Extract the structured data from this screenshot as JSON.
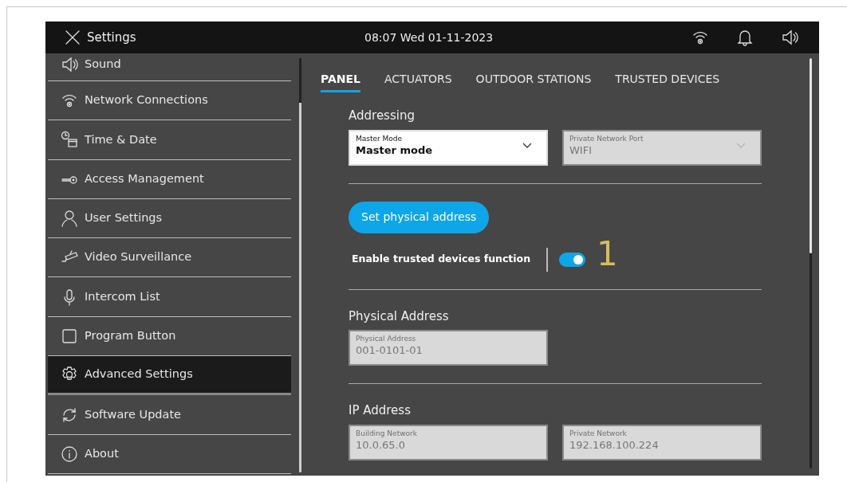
{
  "header": {
    "title": "Settings",
    "datetime": "08:07  Wed 01-11-2023"
  },
  "sidebar": {
    "items": [
      {
        "label": "Sound",
        "selected": false
      },
      {
        "label": "Network Connections",
        "selected": false
      },
      {
        "label": "Time & Date",
        "selected": false
      },
      {
        "label": "Access Management",
        "selected": false
      },
      {
        "label": "User Settings",
        "selected": false
      },
      {
        "label": "Video Surveillance",
        "selected": false
      },
      {
        "label": "Intercom List",
        "selected": false
      },
      {
        "label": "Program Button",
        "selected": false
      },
      {
        "label": "Advanced Settings",
        "selected": true
      },
      {
        "label": "Software Update",
        "selected": false
      },
      {
        "label": "About",
        "selected": false
      }
    ]
  },
  "tabs": [
    {
      "label": "PANEL",
      "selected": true
    },
    {
      "label": "ACTUATORS",
      "selected": false
    },
    {
      "label": "OUTDOOR STATIONS",
      "selected": false
    },
    {
      "label": "TRUSTED DEVICES",
      "selected": false
    }
  ],
  "sections": [
    {
      "kind": "fields",
      "title": "Addressing",
      "fields": [
        {
          "label": "Master Mode",
          "value": "Master mode",
          "disabled": false,
          "dropdown": true
        },
        {
          "label": "Private Network Port",
          "value": "WIFI",
          "disabled": true,
          "dropdown": true
        }
      ]
    },
    {
      "kind": "actions",
      "button": "Set physical address",
      "toggle": {
        "label": "Enable trusted devices function",
        "on": true
      },
      "annotation": "1"
    },
    {
      "kind": "fields",
      "title": "Physical Address",
      "fields": [
        {
          "label": "Physical Address",
          "value": "001-0101-01",
          "disabled": true,
          "dropdown": false
        }
      ]
    },
    {
      "kind": "fields",
      "title": "IP Address",
      "fields": [
        {
          "label": "Building Network",
          "value": "10.0.65.0",
          "disabled": true,
          "dropdown": false
        },
        {
          "label": "Private Network",
          "value": "192.168.100.224",
          "disabled": true,
          "dropdown": false
        }
      ]
    }
  ]
}
